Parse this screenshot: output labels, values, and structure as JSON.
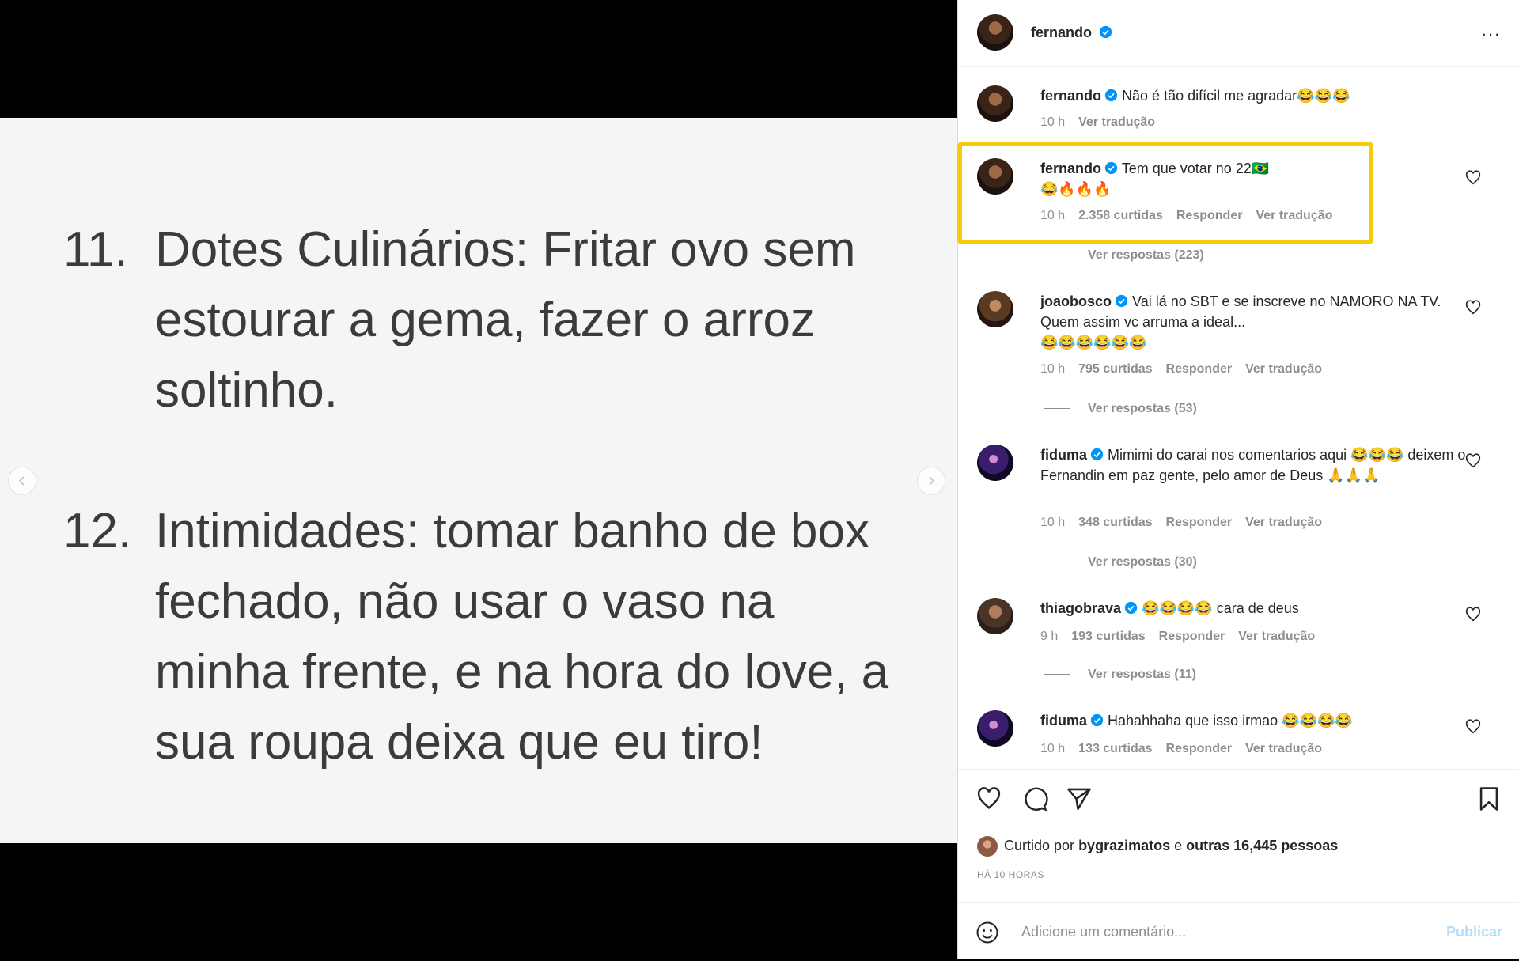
{
  "post": {
    "items": [
      {
        "number": "11.",
        "text": "Dotes Culinários: Fritar ovo sem estourar a gema, fazer o arroz soltinho."
      },
      {
        "number": "12.",
        "text": "Intimidades: tomar banho de box fechado, não usar o vaso na minha frente, e na hora do love, a sua roupa deixa que eu tiro!"
      }
    ]
  },
  "header": {
    "username": "fernando",
    "avatar_icon": "profile-avatar",
    "more_icon": "more-options-icon",
    "more_label": "···"
  },
  "caption": {
    "username": "fernando",
    "text": "Não é tão difícil me agradar😂😂😂",
    "time": "10 h",
    "translate": "Ver tradução"
  },
  "comments": [
    {
      "username": "fernando",
      "text": "Tem que votar no 22🇧🇷",
      "line2": "😂🔥🔥🔥",
      "time": "10 h",
      "likes": "2.358 curtidas",
      "reply": "Responder",
      "translate": "Ver tradução",
      "replies": "Ver respostas (223)",
      "highlighted": true
    },
    {
      "username": "joaobosco",
      "text": "Vai lá no SBT e se inscreve no NAMORO NA TV. Quem assim vc arruma a ideal...",
      "line2": "😂😂😂😂😂😂",
      "time": "10 h",
      "likes": "795 curtidas",
      "reply": "Responder",
      "translate": "Ver tradução",
      "replies": "Ver respostas (53)"
    },
    {
      "username": "fiduma",
      "text": "Mimimi do carai nos comentarios aqui 😂😂😂 deixem o Fernandin em paz gente, pelo amor de Deus 🙏🙏🙏",
      "line2": "",
      "time": "10 h",
      "likes": "348 curtidas",
      "reply": "Responder",
      "translate": "Ver tradução",
      "replies": "Ver respostas (30)"
    },
    {
      "username": "thiagobrava",
      "text": "😂😂😂😂 cara de deus",
      "line2": "",
      "time": "9 h",
      "likes": "193 curtidas",
      "reply": "Responder",
      "translate": "Ver tradução",
      "replies": "Ver respostas (11)"
    },
    {
      "username": "fiduma",
      "text": "Hahahhaha que isso irmao 😂😂😂😂",
      "line2": "",
      "time": "10 h",
      "likes": "133 curtidas",
      "reply": "Responder",
      "translate": "Ver tradução",
      "replies": ""
    }
  ],
  "actions": {
    "like_icon": "heart-icon",
    "comment_icon": "comment-icon",
    "share_icon": "share-icon",
    "save_icon": "bookmark-icon",
    "liked_prefix": "Curtido por",
    "liked_user": "bygrazimatos",
    "liked_and": "e",
    "liked_others": "outras 16,445 pessoas",
    "time_ago": "HÁ 10 HORAS"
  },
  "add_comment": {
    "placeholder": "Adicione um comentário...",
    "publish": "Publicar"
  },
  "colors": {
    "highlight": "#f5cc0c",
    "verified": "#0095f6",
    "publish_disabled": "#b2dffc"
  }
}
